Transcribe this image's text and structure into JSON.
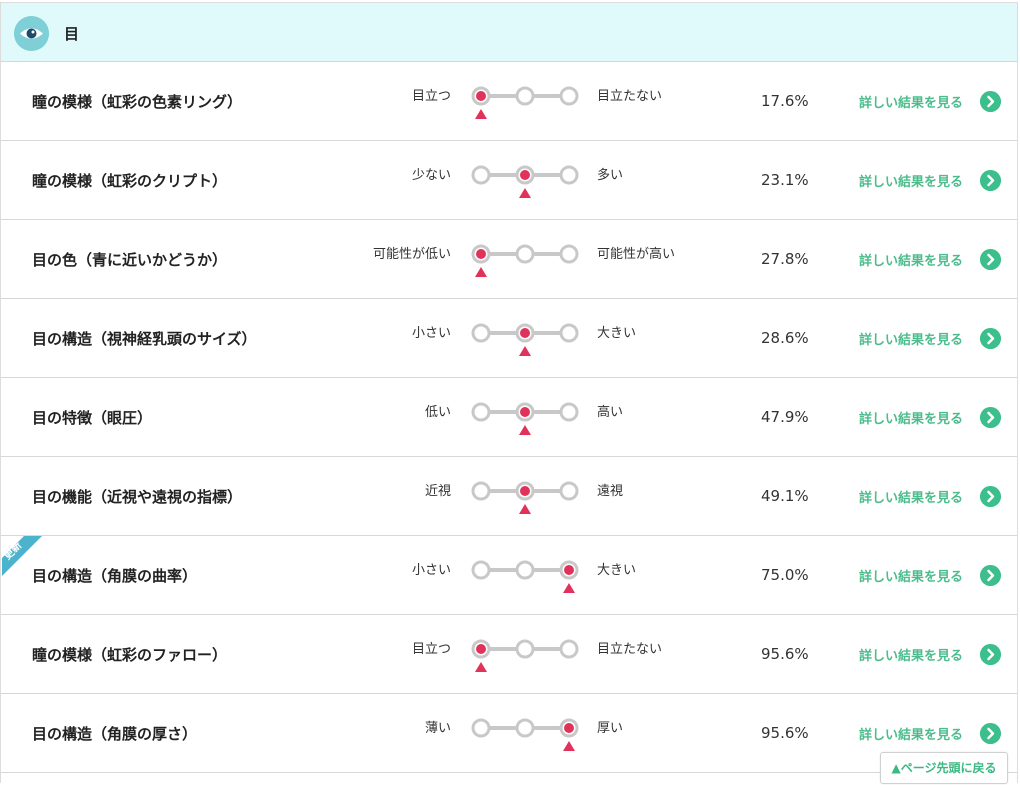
{
  "section": {
    "title": "目",
    "icon": "eye-icon",
    "icon_color": "#7fd0d6"
  },
  "colors": {
    "accent": "#3cbf8c",
    "marker": "#e0325a",
    "header_bg": "#e0fafc",
    "badge": "#4bb3cc"
  },
  "detail_label": "詳しい結果を見る",
  "back_to_top": "▲ページ先頭に戻る",
  "rows": [
    {
      "name": "瞳の模様（虹彩の色素リング）",
      "left": "目立つ",
      "right": "目立たない",
      "position": 0,
      "percent": "17.6%",
      "badge": ""
    },
    {
      "name": "瞳の模様（虹彩のクリプト）",
      "left": "少ない",
      "right": "多い",
      "position": 1,
      "percent": "23.1%",
      "badge": ""
    },
    {
      "name": "目の色（青に近いかどうか）",
      "left": "可能性が低い",
      "right": "可能性が高い",
      "position": 0,
      "percent": "27.8%",
      "badge": ""
    },
    {
      "name": "目の構造（視神経乳頭のサイズ）",
      "left": "小さい",
      "right": "大きい",
      "position": 1,
      "percent": "28.6%",
      "badge": ""
    },
    {
      "name": "目の特徴（眼圧）",
      "left": "低い",
      "right": "高い",
      "position": 1,
      "percent": "47.9%",
      "badge": ""
    },
    {
      "name": "目の機能（近視や遠視の指標）",
      "left": "近視",
      "right": "遠視",
      "position": 1,
      "percent": "49.1%",
      "badge": ""
    },
    {
      "name": "目の構造（角膜の曲率）",
      "left": "小さい",
      "right": "大きい",
      "position": 2,
      "percent": "75.0%",
      "badge": "更新"
    },
    {
      "name": "瞳の模様（虹彩のファロー）",
      "left": "目立つ",
      "right": "目立たない",
      "position": 0,
      "percent": "95.6%",
      "badge": ""
    },
    {
      "name": "目の構造（角膜の厚さ）",
      "left": "薄い",
      "right": "厚い",
      "position": 2,
      "percent": "95.6%",
      "badge": ""
    }
  ]
}
